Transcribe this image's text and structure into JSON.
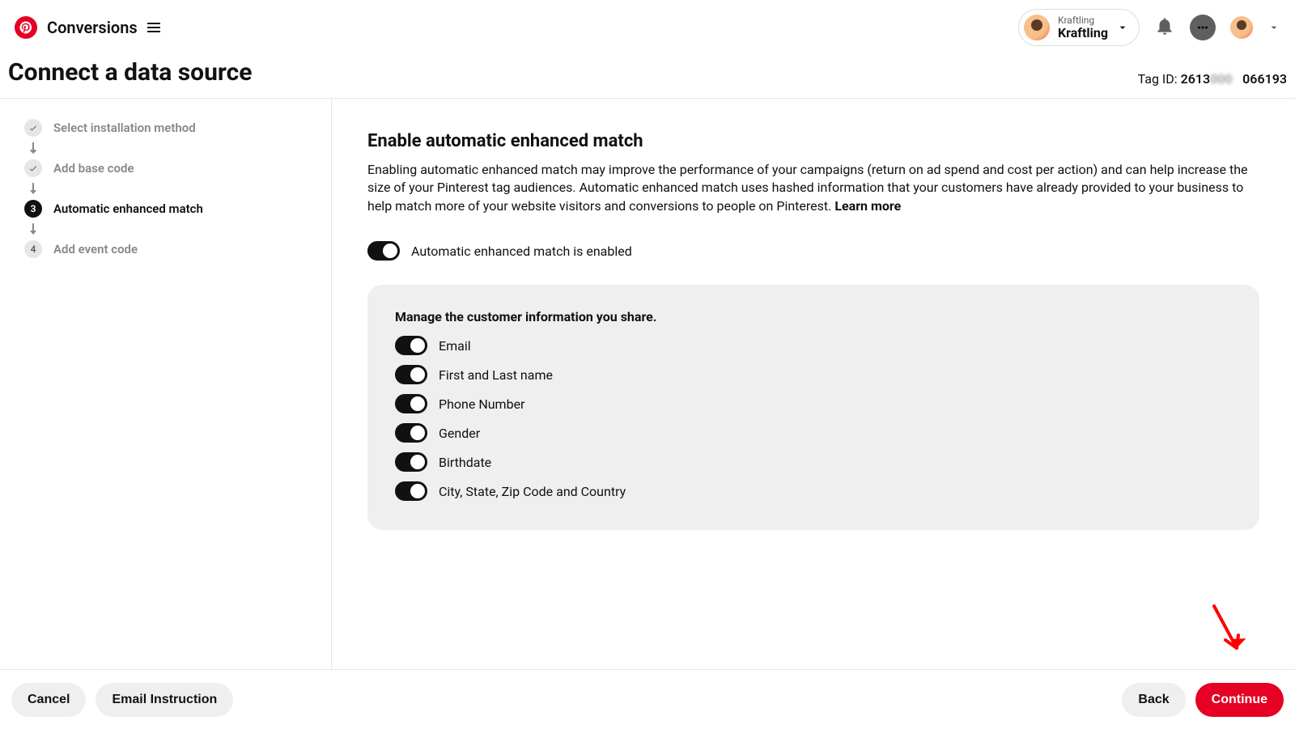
{
  "header": {
    "breadcrumb": "Conversions",
    "account_top": "Kraftling",
    "account_bottom": "Kraftling"
  },
  "page": {
    "title": "Connect a data source",
    "tag_id_label": "Tag ID:",
    "tag_id_prefix": "2613",
    "tag_id_mid": "000",
    "tag_id_suffix": "066193"
  },
  "steps": {
    "s1": "Select installation method",
    "s2": "Add base code",
    "s3": "Automatic enhanced match",
    "s4": "Add event code",
    "current_num": "3",
    "s4_num": "4"
  },
  "main": {
    "section_title": "Enable automatic enhanced match",
    "section_desc": "Enabling automatic enhanced match may improve the performance of your campaigns (return on ad spend and cost per action) and can help increase the size of your Pinterest tag audiences. Automatic enhanced match uses hashed information that your customers have already provided to your business to help match more of your website visitors and conversions to people on Pinterest. ",
    "learn_more": "Learn more",
    "master_toggle_label": "Automatic enhanced match is enabled",
    "panel_title": "Manage the customer information you share.",
    "options": {
      "email": "Email",
      "name": "First and Last name",
      "phone": "Phone Number",
      "gender": "Gender",
      "birthdate": "Birthdate",
      "location": "City, State, Zip Code and Country"
    }
  },
  "footer": {
    "cancel": "Cancel",
    "email_instruction": "Email Instruction",
    "back": "Back",
    "continue": "Continue"
  }
}
